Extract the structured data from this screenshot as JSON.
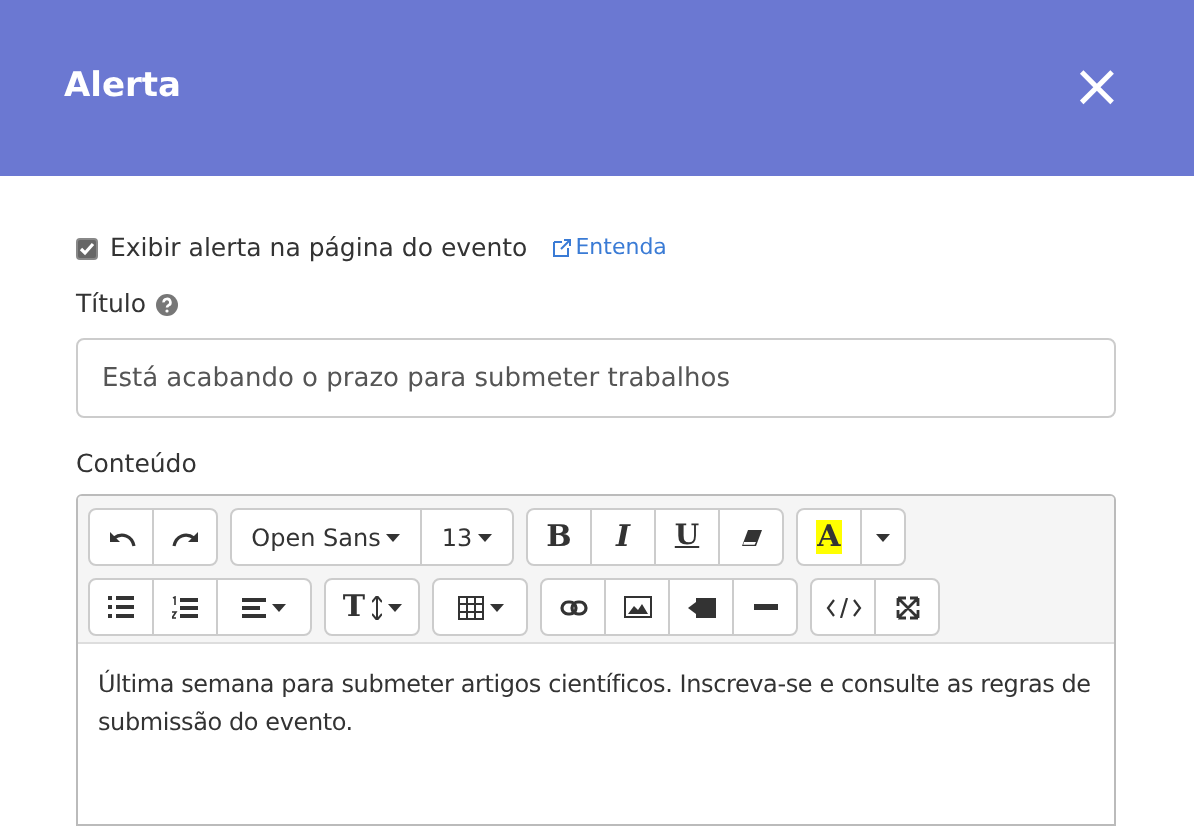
{
  "header": {
    "title": "Alerta",
    "close": "×"
  },
  "show_alert": {
    "label": "Exibir alerta na página do evento",
    "checked": true,
    "link": "Entenda"
  },
  "title_field": {
    "label": "Título",
    "value": "Está acabando o prazo para submeter trabalhos"
  },
  "content_label": "Conteúdo",
  "toolbar": [
    [
      [
        {
          "kind": "undo"
        },
        {
          "kind": "redo"
        }
      ],
      [
        {
          "kind": "font",
          "label": "Open Sans"
        },
        {
          "kind": "size",
          "label": "13"
        }
      ],
      [
        {
          "kind": "bold",
          "label": "B"
        },
        {
          "kind": "italic",
          "label": "I"
        },
        {
          "kind": "underline",
          "label": "U"
        },
        {
          "kind": "eraser"
        }
      ],
      [
        {
          "kind": "color",
          "label": "A"
        },
        {
          "kind": "caret"
        }
      ]
    ],
    [
      [
        {
          "kind": "ul"
        },
        {
          "kind": "ol"
        },
        {
          "kind": "align"
        }
      ],
      [
        {
          "kind": "height",
          "label": "T"
        }
      ],
      [
        {
          "kind": "table"
        }
      ],
      [
        {
          "kind": "link"
        },
        {
          "kind": "image"
        },
        {
          "kind": "video"
        },
        {
          "kind": "hr"
        }
      ],
      [
        {
          "kind": "code"
        },
        {
          "kind": "fullscreen"
        }
      ]
    ]
  ],
  "content": "Última semana para submeter artigos científicos. Inscreva-se e consulte as regras de submissão do evento."
}
